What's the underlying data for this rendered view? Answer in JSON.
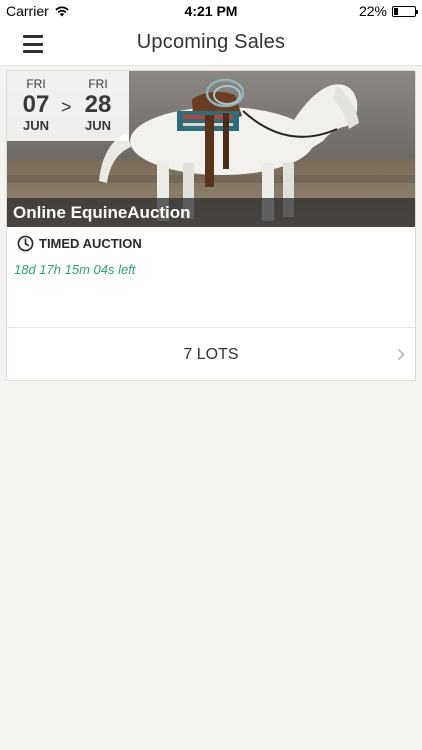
{
  "status_bar": {
    "carrier": "Carrier",
    "time": "4:21 PM",
    "battery": "22%",
    "battery_level": 0.22,
    "wifi_icon": "wifi-icon"
  },
  "nav": {
    "title": "Upcoming Sales",
    "menu_icon": "hamburger-menu-icon"
  },
  "sale": {
    "start": {
      "dow": "FRI",
      "day": "07",
      "month": "JUN"
    },
    "separator": ">",
    "end": {
      "dow": "FRI",
      "day": "28",
      "month": "JUN"
    },
    "title": "Online EquineAuction",
    "type": "TIMED AUCTION",
    "countdown": "18d 17h 15m 04s left",
    "lots": "7 LOTS",
    "image": "white-horse-saddled-photo"
  },
  "colors": {
    "background": "#f4f3ef",
    "countdown": "#2ea36f",
    "title_bar": "#282828"
  }
}
